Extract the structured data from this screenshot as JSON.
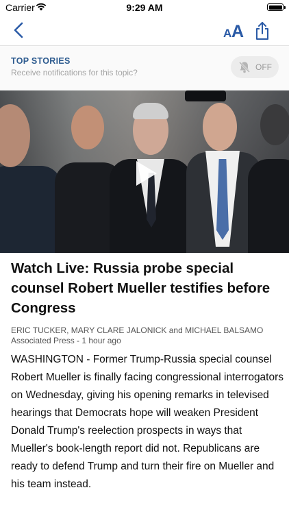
{
  "status_bar": {
    "carrier": "Carrier",
    "time": "9:29 AM"
  },
  "nav": {
    "text_size_small": "A",
    "text_size_large": "A"
  },
  "topic": {
    "title": "TOP STORIES",
    "subtitle": "Receive notifications for this topic?",
    "toggle_label": "OFF"
  },
  "article": {
    "headline": "Watch Live: Russia probe special counsel Robert Mueller testifies before Congress",
    "authors": "ERIC TUCKER, MARY CLARE JALONICK and MICHAEL BALSAMO",
    "source_time": "Associated Press - 1 hour ago",
    "body": "WASHINGTON - Former Trump-Russia special counsel Robert Mueller is finally facing congressional interrogators on Wednesday, giving his opening remarks in televised hearings that Democrats hope will weaken President Donald Trump's reelection prospects in ways that Mueller's book-length report did not. Republicans are ready to defend Trump and turn their fire on Mueller and his team instead."
  },
  "colors": {
    "accent": "#2a5aa6",
    "topic_title": "#2d5b8f"
  },
  "icons": [
    "wifi-icon",
    "battery-icon",
    "back-chevron-icon",
    "text-size-icon",
    "share-icon",
    "bell-off-icon",
    "play-icon"
  ]
}
